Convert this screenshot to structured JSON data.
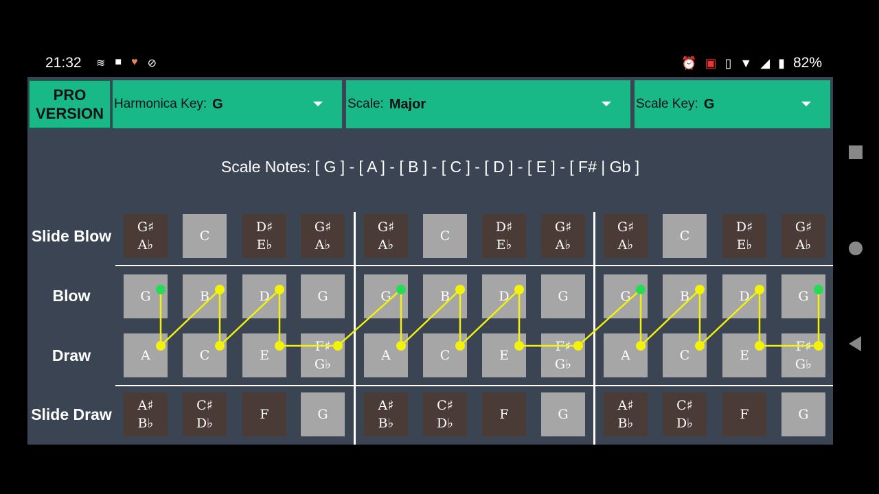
{
  "status": {
    "time": "21:32",
    "battery": "82%",
    "left_icons": [
      "signal-app-icon",
      "video-icon",
      "heart-icon",
      "notifications-off-icon"
    ],
    "right_icons": [
      "alarm-icon",
      "cast-icon",
      "vibrate-icon",
      "wifi-icon",
      "4g-signal-icon",
      "battery-icon"
    ]
  },
  "toolbar": {
    "pro_line1": "PRO",
    "pro_line2": "VERSION",
    "harmonica_key_label": "Harmonica Key:",
    "harmonica_key_value": "G",
    "scale_label": "Scale:",
    "scale_value": "Major",
    "scale_key_label": "Scale Key:",
    "scale_key_value": "G"
  },
  "scale_notes": "Scale Notes: [ G ] - [ A ] - [ B ] - [ C ] - [ D ] - [ E ] - [ F# | Gb ]",
  "rows": {
    "slide_blow": "Slide Blow",
    "blow": "Blow",
    "draw": "Draw",
    "slide_draw": "Slide Draw"
  },
  "grid": {
    "slide_blow": [
      [
        "G♯",
        "A♭"
      ],
      [
        "C"
      ],
      [
        "D♯",
        "E♭"
      ],
      [
        "G♯",
        "A♭"
      ],
      [
        "G♯",
        "A♭"
      ],
      [
        "C"
      ],
      [
        "D♯",
        "E♭"
      ],
      [
        "G♯",
        "A♭"
      ],
      [
        "G♯",
        "A♭"
      ],
      [
        "C"
      ],
      [
        "D♯",
        "E♭"
      ],
      [
        "G♯",
        "A♭"
      ]
    ],
    "blow": [
      [
        "G"
      ],
      [
        "B"
      ],
      [
        "D"
      ],
      [
        "G"
      ],
      [
        "G"
      ],
      [
        "B"
      ],
      [
        "D"
      ],
      [
        "G"
      ],
      [
        "G"
      ],
      [
        "B"
      ],
      [
        "D"
      ],
      [
        "G"
      ]
    ],
    "draw": [
      [
        "A"
      ],
      [
        "C"
      ],
      [
        "E"
      ],
      [
        "F♯",
        "G♭"
      ],
      [
        "A"
      ],
      [
        "C"
      ],
      [
        "E"
      ],
      [
        "F♯",
        "G♭"
      ],
      [
        "A"
      ],
      [
        "C"
      ],
      [
        "E"
      ],
      [
        "F♯",
        "G♭"
      ]
    ],
    "slide_draw": [
      [
        "A♯",
        "B♭"
      ],
      [
        "C♯",
        "D♭"
      ],
      [
        "F"
      ],
      [
        "G"
      ],
      [
        "A♯",
        "B♭"
      ],
      [
        "C♯",
        "D♭"
      ],
      [
        "F"
      ],
      [
        "G"
      ],
      [
        "A♯",
        "B♭"
      ],
      [
        "C♯",
        "D♭"
      ],
      [
        "F"
      ],
      [
        "G"
      ]
    ],
    "slide_blow_shade": [
      "dark",
      "light",
      "dark",
      "dark",
      "dark",
      "light",
      "dark",
      "dark",
      "dark",
      "light",
      "dark",
      "dark"
    ],
    "slide_draw_shade": [
      "dark",
      "dark",
      "dark",
      "light",
      "dark",
      "dark",
      "dark",
      "light",
      "dark",
      "dark",
      "dark",
      "light"
    ]
  },
  "colors": {
    "accent": "#18b887",
    "path": "#f2f20a",
    "root": "#22dd55",
    "background": "#3b4453"
  }
}
